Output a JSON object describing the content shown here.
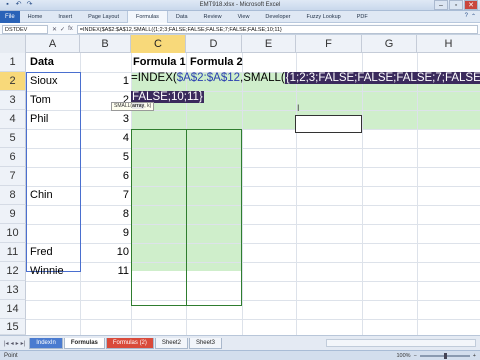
{
  "window": {
    "title": "EMT918.xlsx - Microsoft Excel",
    "controls": [
      "–",
      "▫",
      "✕"
    ]
  },
  "quick_access": [
    "save-icon",
    "undo-icon",
    "redo-icon"
  ],
  "ribbon": {
    "file_tab": "File",
    "tabs": [
      "Home",
      "Insert",
      "Page Layout",
      "Formulas",
      "Data",
      "Review",
      "View",
      "Developer",
      "Fuzzy Lookup",
      "PDF"
    ],
    "active_tab": "Formulas"
  },
  "formula_bar": {
    "name_box": "DSTDEV",
    "cancel_icon": "✕",
    "enter_icon": "✓",
    "fx_label": "fx",
    "formula": "=INDEX($A$2:$A$12,SMALL({1;2;3;FALSE;FALSE;FALSE;7;FALSE;FALSE;10;11}"
  },
  "columns": [
    "A",
    "B",
    "C",
    "D",
    "E",
    "F",
    "G",
    "H"
  ],
  "rows": [
    "1",
    "2",
    "3",
    "4",
    "5",
    "6",
    "7",
    "8",
    "9",
    "10",
    "11",
    "12",
    "13",
    "14",
    "15"
  ],
  "cells": {
    "A1": "Data",
    "C1": "Formula 1",
    "D1": "Formula 2",
    "A2": "Sioux",
    "A3": "Tom",
    "A4": "Phil",
    "A8": "Chin",
    "A11": "Fred",
    "A12": "Winnie",
    "B2": "1",
    "B3": "2",
    "B4": "3",
    "B5": "4",
    "B6": "5",
    "B7": "6",
    "B8": "7",
    "B9": "8",
    "B10": "9",
    "B11": "10",
    "B12": "11"
  },
  "edit": {
    "prefix": "=INDEX(",
    "ref": "$A$2:$A$12",
    "mid": ",SMALL(",
    "highlight_line1": "{1;2;3;FALSE;FALSE;FALSE;7;FALSE;",
    "highlight_line2": "FALSE;10;11}",
    "tooltip_fn": "SMALL(",
    "tooltip_arg": "array",
    "tooltip_rest": ", k)"
  },
  "sheets": {
    "tabs": [
      "IndexIn",
      "Formulas",
      "Formulas (2)",
      "Sheet2",
      "Sheet3"
    ],
    "active": "Formulas"
  },
  "status": {
    "mode": "Point",
    "zoom": "100%"
  },
  "colors": {
    "selection_fill": "#cfeecb",
    "array_highlight": "#3a2a5c",
    "active_header": "#f8d97a",
    "ribbon_blue": "#2a63b8"
  }
}
